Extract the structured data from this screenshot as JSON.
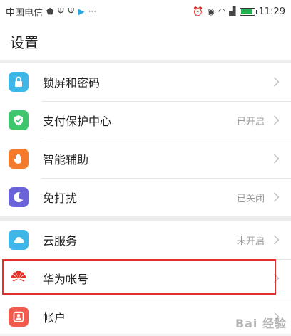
{
  "status_bar": {
    "carrier": "中国电信",
    "time": "11:29",
    "left_icons": [
      "shield-icon",
      "usb-icon",
      "usb-icon",
      "play-store-icon",
      "more-icon"
    ],
    "right_icons": [
      "alarm-icon",
      "eye-icon",
      "wifi-icon",
      "signal-icon",
      "battery-icon"
    ]
  },
  "header": {
    "title": "设置"
  },
  "groups": [
    {
      "items": [
        {
          "label": "锁屏和密码",
          "status": "",
          "icon": "lock-icon",
          "color": "#3fb6e8"
        },
        {
          "label": "支付保护中心",
          "status": "已开启",
          "icon": "shield-check-icon",
          "color": "#3fc56b"
        },
        {
          "label": "智能辅助",
          "status": "",
          "icon": "hand-icon",
          "color": "#f47a2c"
        },
        {
          "label": "免打扰",
          "status": "已关闭",
          "icon": "moon-icon",
          "color": "#6b63d9"
        }
      ]
    },
    {
      "items": [
        {
          "label": "云服务",
          "status": "未开启",
          "icon": "cloud-icon",
          "color": "#3fb6e8"
        },
        {
          "label": "华为帐号",
          "status": "",
          "icon": "huawei-logo-icon",
          "color": "#e8302a"
        },
        {
          "label": "帐户",
          "status": "",
          "icon": "account-icon",
          "color": "#f35a4e"
        }
      ]
    }
  ],
  "highlight_color": "#e03030",
  "watermark": "Bai 经验"
}
